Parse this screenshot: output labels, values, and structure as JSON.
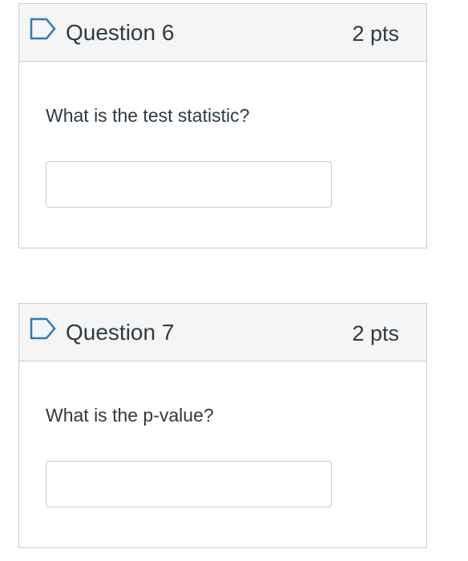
{
  "questions": [
    {
      "title": "Question 6",
      "points": "2 pts",
      "text": "What is the test statistic?",
      "answer_value": "",
      "flag_icon": "bookmark-flag-icon"
    },
    {
      "title": "Question 7",
      "points": "2 pts",
      "text": "What is the p-value?",
      "answer_value": "",
      "flag_icon": "bookmark-flag-icon"
    }
  ],
  "colors": {
    "flag": "#2b7abc",
    "header_bg": "#f5f5f5",
    "border": "#c7cdd1",
    "text": "#2d3b45"
  }
}
